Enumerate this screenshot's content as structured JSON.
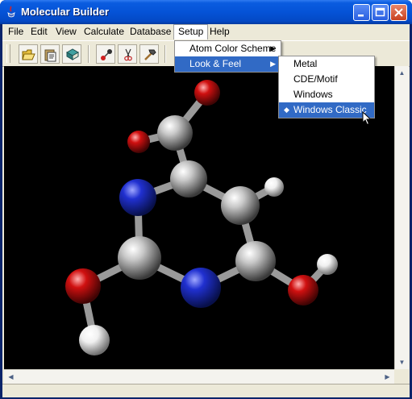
{
  "window": {
    "title": "Molecular Builder"
  },
  "menubar": {
    "items": [
      {
        "label": "File"
      },
      {
        "label": "Edit"
      },
      {
        "label": "View"
      },
      {
        "label": "Calculate"
      },
      {
        "label": "Database"
      },
      {
        "label": "Setup"
      },
      {
        "label": "Help"
      }
    ]
  },
  "toolbar": {
    "tools": [
      "open-folder-icon",
      "clipboard-icon",
      "book-icon",
      "bond-icon",
      "scissors-icon",
      "hammer-icon"
    ]
  },
  "setup_menu": {
    "items": [
      {
        "label": "Atom Color Scheme",
        "has_submenu": true,
        "highlighted": false
      },
      {
        "label": "Look & Feel",
        "has_submenu": true,
        "highlighted": true
      }
    ]
  },
  "look_feel_menu": {
    "items": [
      {
        "label": "Metal",
        "selected": false
      },
      {
        "label": "CDE/Motif",
        "selected": false
      },
      {
        "label": "Windows",
        "selected": false
      },
      {
        "label": "Windows Classic",
        "selected": true
      }
    ],
    "selected_marker": "◆"
  },
  "molecule": {
    "atom_colors": {
      "carbon": "#c8c8c8",
      "nitrogen": "#2030d0",
      "oxygen": "#d01010",
      "hydrogen": "#f0f0f0"
    },
    "background": "#000000"
  },
  "colors": {
    "titlebar": "#0553d7",
    "menu_highlight": "#316ac5",
    "chrome": "#ece9d8"
  }
}
